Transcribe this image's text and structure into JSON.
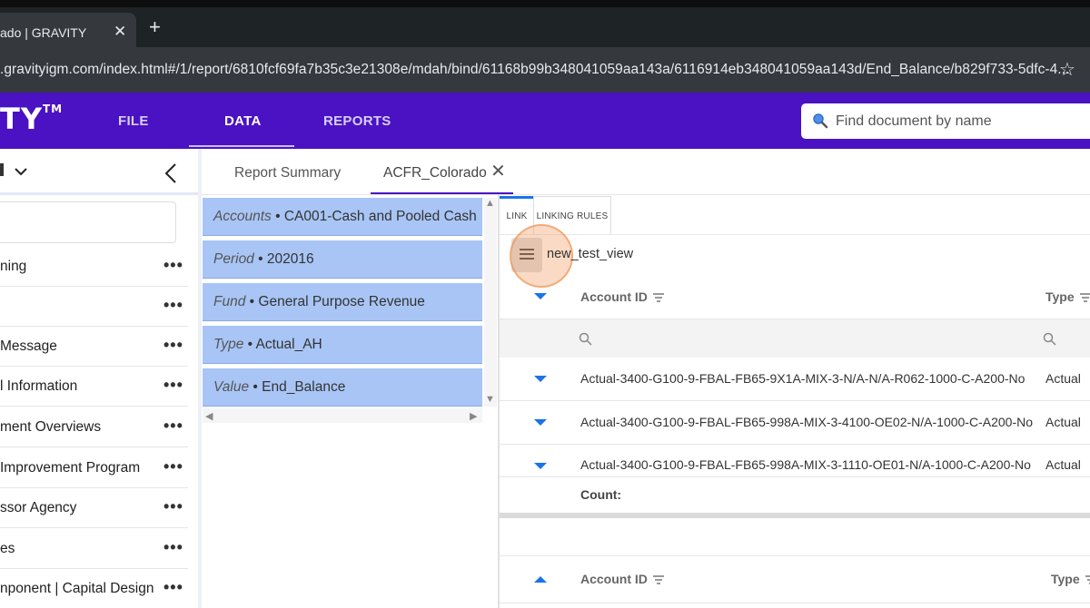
{
  "browser": {
    "tab_title": "ado | GRAVITY",
    "tab_close": "✕",
    "new_tab": "+",
    "url": ".gravityigm.com/index.html#/1/report/6810fcf69fa7b35c3e21308e/mdah/bind/61168b99b348041059aa143a/6116914eb348041059aa143d/End_Balance/b829f733-5dfc-4...",
    "star": "☆"
  },
  "header": {
    "logo": "TY",
    "logo_tm": "TM",
    "nav": [
      {
        "label": "FILE",
        "active": false
      },
      {
        "label": "DATA",
        "active": true
      },
      {
        "label": "REPORTS",
        "active": false
      }
    ],
    "search_placeholder": "Find document by name"
  },
  "sidebar": {
    "items": [
      {
        "label": "ning"
      },
      {
        "label": ""
      },
      {
        "label": " Message"
      },
      {
        "label": "l Information"
      },
      {
        "label": "ment Overviews"
      },
      {
        "label": " Improvement Program"
      },
      {
        "label": "ssor Agency"
      },
      {
        "label": "es"
      },
      {
        "label": "nponent | Capital Design"
      }
    ],
    "more": "•••"
  },
  "report_tabs": [
    {
      "label": "Report Summary",
      "active": false
    },
    {
      "label": "ACFR_Colorado",
      "active": true
    }
  ],
  "report_tab_close": "✕",
  "filters": [
    {
      "key": "Accounts",
      "value": "CA001-Cash and Pooled Cash"
    },
    {
      "key": "Period",
      "value": "202016"
    },
    {
      "key": "Fund",
      "value": "General Purpose Revenue"
    },
    {
      "key": "Type",
      "value": "Actual_AH"
    },
    {
      "key": "Value",
      "value": "End_Balance"
    }
  ],
  "filter_sep": " • ",
  "link_tabs": {
    "link": "LINK",
    "rules": "LINKING RULES"
  },
  "view_name": "new_test_view",
  "grid": {
    "columns": [
      "Account ID",
      "Type"
    ],
    "rows": [
      {
        "account_id": "Actual-3400-G100-9-FBAL-FB65-9X1A-MIX-3-N/A-N/A-R062-1000-C-A200-No",
        "type": "Actual"
      },
      {
        "account_id": "Actual-3400-G100-9-FBAL-FB65-998A-MIX-3-4100-OE02-N/A-1000-C-A200-No",
        "type": "Actual"
      },
      {
        "account_id": "Actual-3400-G100-9-FBAL-FB65-998A-MIX-3-1110-OE01-N/A-1000-C-A200-No",
        "type": "Actual"
      }
    ],
    "count_label": "Count:"
  },
  "grid2": {
    "columns": [
      "Account ID",
      "Type"
    ]
  },
  "colors": {
    "brand": "#4a12c2",
    "accent": "#1a73e8",
    "filter_bg": "#a8c5f5"
  }
}
